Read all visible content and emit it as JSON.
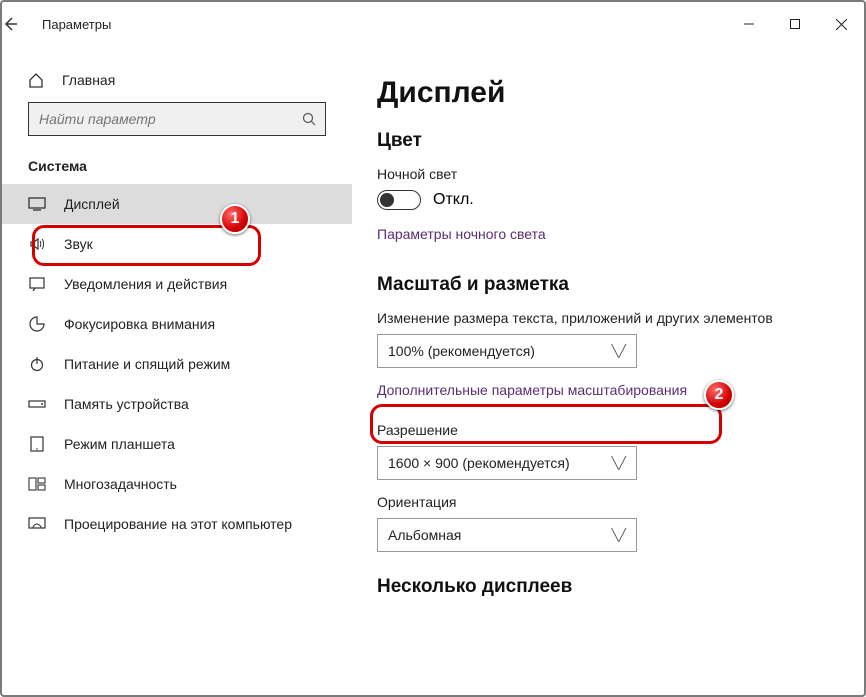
{
  "window": {
    "title": "Параметры"
  },
  "sidebar": {
    "home": "Главная",
    "search_placeholder": "Найти параметр",
    "section": "Система",
    "items": [
      {
        "label": "Дисплей"
      },
      {
        "label": "Звук"
      },
      {
        "label": "Уведомления и действия"
      },
      {
        "label": "Фокусировка внимания"
      },
      {
        "label": "Питание и спящий режим"
      },
      {
        "label": "Память устройства"
      },
      {
        "label": "Режим планшета"
      },
      {
        "label": "Многозадачность"
      },
      {
        "label": "Проецирование на этот компьютер"
      }
    ]
  },
  "main": {
    "title": "Дисплей",
    "color_heading": "Цвет",
    "night_light_label": "Ночной свет",
    "night_light_state": "Откл.",
    "night_light_link": "Параметры ночного света",
    "scale_heading": "Масштаб и разметка",
    "scale_desc": "Изменение размера текста, приложений и других элементов",
    "scale_value": "100% (рекомендуется)",
    "scale_link": "Дополнительные параметры масштабирования",
    "resolution_label": "Разрешение",
    "resolution_value": "1600 × 900 (рекомендуется)",
    "orientation_label": "Ориентация",
    "orientation_value": "Альбомная",
    "multi_heading": "Несколько дисплеев"
  },
  "annotations": {
    "badge1": "1",
    "badge2": "2"
  }
}
